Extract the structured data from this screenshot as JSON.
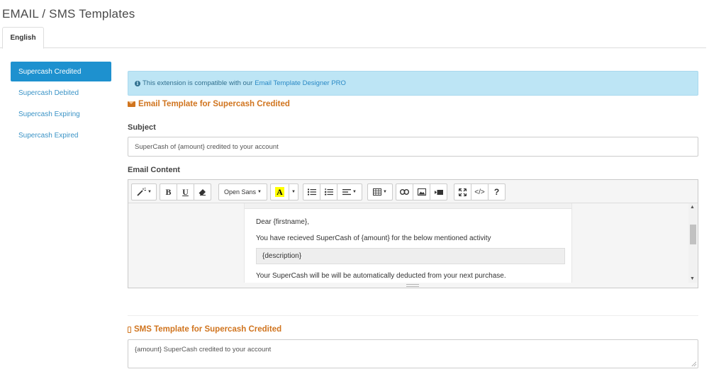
{
  "page": {
    "title": "EMAIL / SMS Templates"
  },
  "tabs": [
    {
      "label": "English",
      "active": true
    }
  ],
  "sidebar": {
    "items": [
      {
        "label": "Supercash Credited",
        "active": true
      },
      {
        "label": "Supercash Debited",
        "active": false
      },
      {
        "label": "Supercash Expiring",
        "active": false
      },
      {
        "label": "Supercash Expired",
        "active": false
      }
    ]
  },
  "alert": {
    "icon": "info-icon",
    "text": "This extension is compatible with our",
    "link": "Email Template Designer PRO"
  },
  "email": {
    "heading": "Email Template for Supercash Credited",
    "subject_label": "Subject",
    "subject_value": "SuperCash of {amount} credited to your account",
    "content_label": "Email Content",
    "toolbar": {
      "font_name": "Open Sans",
      "color_letter": "A",
      "bold": "B",
      "underline": "U",
      "code": "</>",
      "help": "?"
    },
    "body": {
      "greeting": "Dear {firstname},",
      "line1": "You have recieved SuperCash of {amount} for the below mentioned activity",
      "description": "{description}",
      "line2": "Your SuperCash will be will be automatically deducted from your next purchase."
    }
  },
  "sms": {
    "heading": "SMS Template for Supercash Credited",
    "value": "{amount} SuperCash credited to your account"
  },
  "colors": {
    "accent": "#1e91cf",
    "heading_orange": "#d0741e",
    "alert_bg": "#bde5f5",
    "link": "#3a93c6"
  }
}
